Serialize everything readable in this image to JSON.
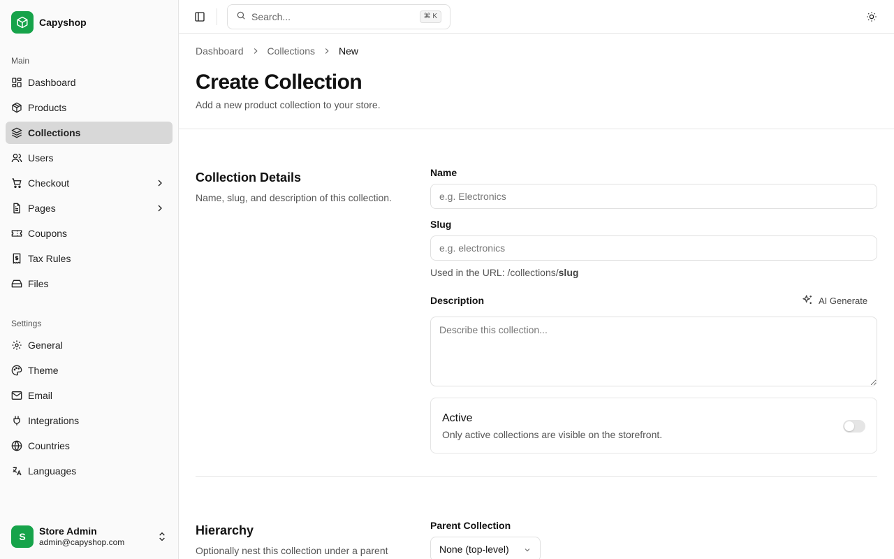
{
  "app": {
    "name": "Capyshop"
  },
  "colors": {
    "brand": "#16a34a"
  },
  "sidebar": {
    "main_label": "Main",
    "main_items": [
      {
        "label": "Dashboard",
        "icon": "dashboard-icon"
      },
      {
        "label": "Products",
        "icon": "package-icon"
      },
      {
        "label": "Collections",
        "icon": "layers-icon",
        "active": true
      },
      {
        "label": "Users",
        "icon": "users-icon"
      },
      {
        "label": "Checkout",
        "icon": "cart-icon",
        "has_children": true
      },
      {
        "label": "Pages",
        "icon": "file-icon",
        "has_children": true
      },
      {
        "label": "Coupons",
        "icon": "ticket-icon"
      },
      {
        "label": "Tax Rules",
        "icon": "receipt-icon"
      },
      {
        "label": "Files",
        "icon": "hard-drive-icon"
      }
    ],
    "settings_label": "Settings",
    "settings_items": [
      {
        "label": "General",
        "icon": "gear-icon"
      },
      {
        "label": "Theme",
        "icon": "palette-icon"
      },
      {
        "label": "Email",
        "icon": "mail-icon"
      },
      {
        "label": "Integrations",
        "icon": "plug-icon"
      },
      {
        "label": "Countries",
        "icon": "globe-icon"
      },
      {
        "label": "Languages",
        "icon": "languages-icon"
      }
    ],
    "user": {
      "initial": "S",
      "name": "Store Admin",
      "email": "admin@capyshop.com"
    }
  },
  "header": {
    "search_placeholder": "Search...",
    "search_shortcut": "⌘ K"
  },
  "breadcrumb": [
    "Dashboard",
    "Collections",
    "New"
  ],
  "page": {
    "title": "Create Collection",
    "subtitle": "Add a new product collection to your store."
  },
  "details_section": {
    "title": "Collection Details",
    "description": "Name, slug, and description of this collection.",
    "name_label": "Name",
    "name_placeholder": "e.g. Electronics",
    "slug_label": "Slug",
    "slug_placeholder": "e.g. electronics",
    "slug_help_prefix": "Used in the URL: /collections/",
    "slug_help_bold": "slug",
    "description_label": "Description",
    "ai_generate_label": "AI Generate",
    "description_placeholder": "Describe this collection...",
    "active_title": "Active",
    "active_desc": "Only active collections are visible on the storefront.",
    "active_on": false
  },
  "hierarchy_section": {
    "title": "Hierarchy",
    "description": "Optionally nest this collection under a parent",
    "parent_label": "Parent Collection",
    "parent_value": "None (top-level)"
  }
}
